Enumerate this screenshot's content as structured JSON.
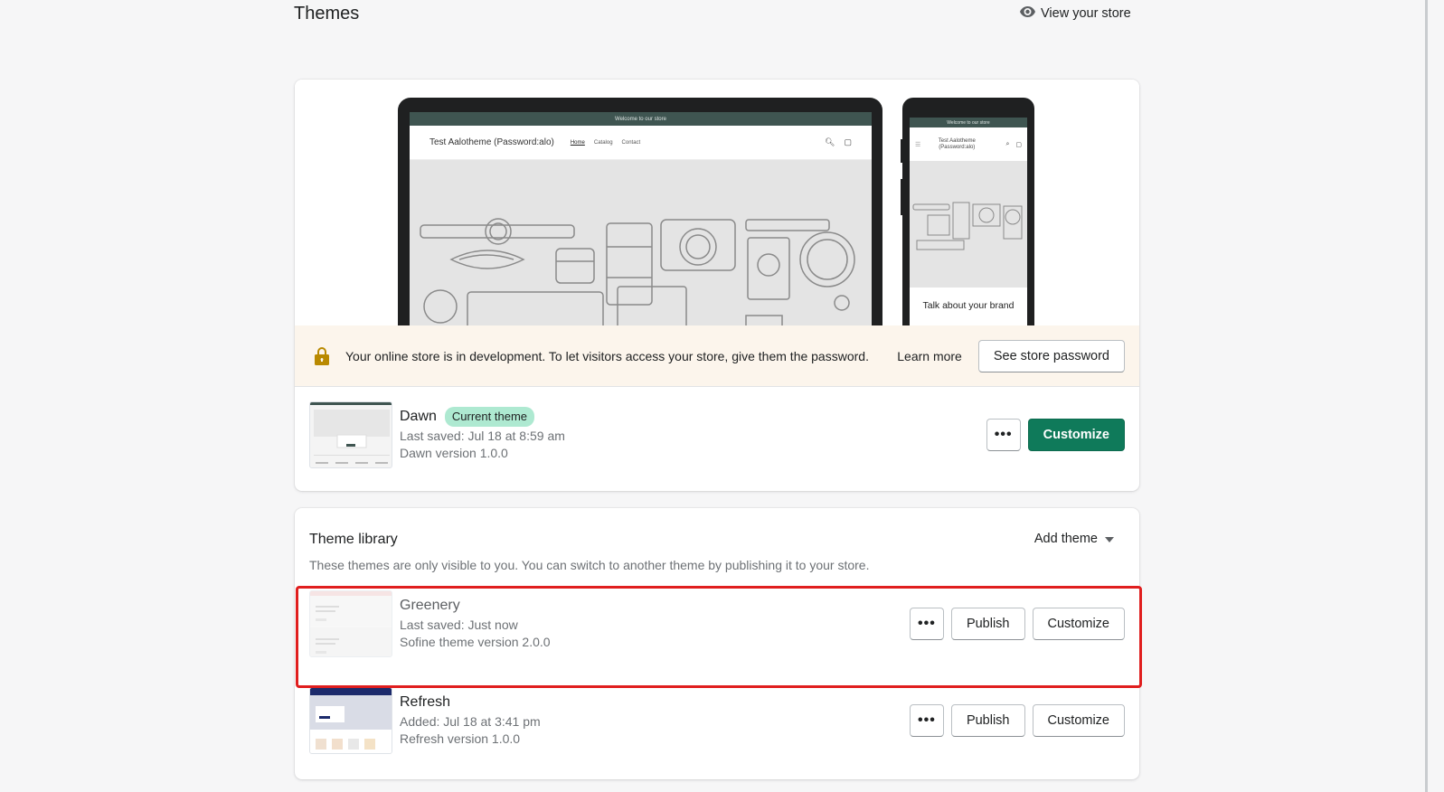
{
  "page": {
    "title": "Themes",
    "view_store": "View your store"
  },
  "preview": {
    "announcement": "Welcome to our store",
    "store_name": "Test Aalotheme (Password:alo)",
    "nav_links": [
      "Home",
      "Catalog",
      "Contact"
    ],
    "mobile_store_name": "Test Aalotheme (Password:alo)",
    "mobile_brand_text": "Talk about your brand"
  },
  "dev_banner": {
    "message": "Your online store is in development. To let visitors access your store, give them the password.",
    "learn_more": "Learn more",
    "button": "See store password"
  },
  "current_theme": {
    "name": "Dawn",
    "badge": "Current theme",
    "last_saved": "Last saved: Jul 18 at 8:59 am",
    "version": "Dawn version 1.0.0",
    "more_label": "•••",
    "customize": "Customize"
  },
  "library": {
    "title": "Theme library",
    "description": "These themes are only visible to you. You can switch to another theme by publishing it to your store.",
    "add_theme": "Add theme",
    "themes": [
      {
        "name": "Greenery",
        "saved": "Last saved: Just now",
        "version": "Sofine theme version 2.0.0",
        "more_label": "•••",
        "publish": "Publish",
        "customize": "Customize"
      },
      {
        "name": "Refresh",
        "saved": "Added: Jul 18 at 3:41 pm",
        "version": "Refresh version 1.0.0",
        "more_label": "•••",
        "publish": "Publish",
        "customize": "Customize"
      }
    ]
  },
  "colors": {
    "primary_button": "#0f7a5a",
    "badge": "#aee9d1",
    "banner_bg": "#fcf5ec",
    "highlight": "#e01e1e"
  }
}
